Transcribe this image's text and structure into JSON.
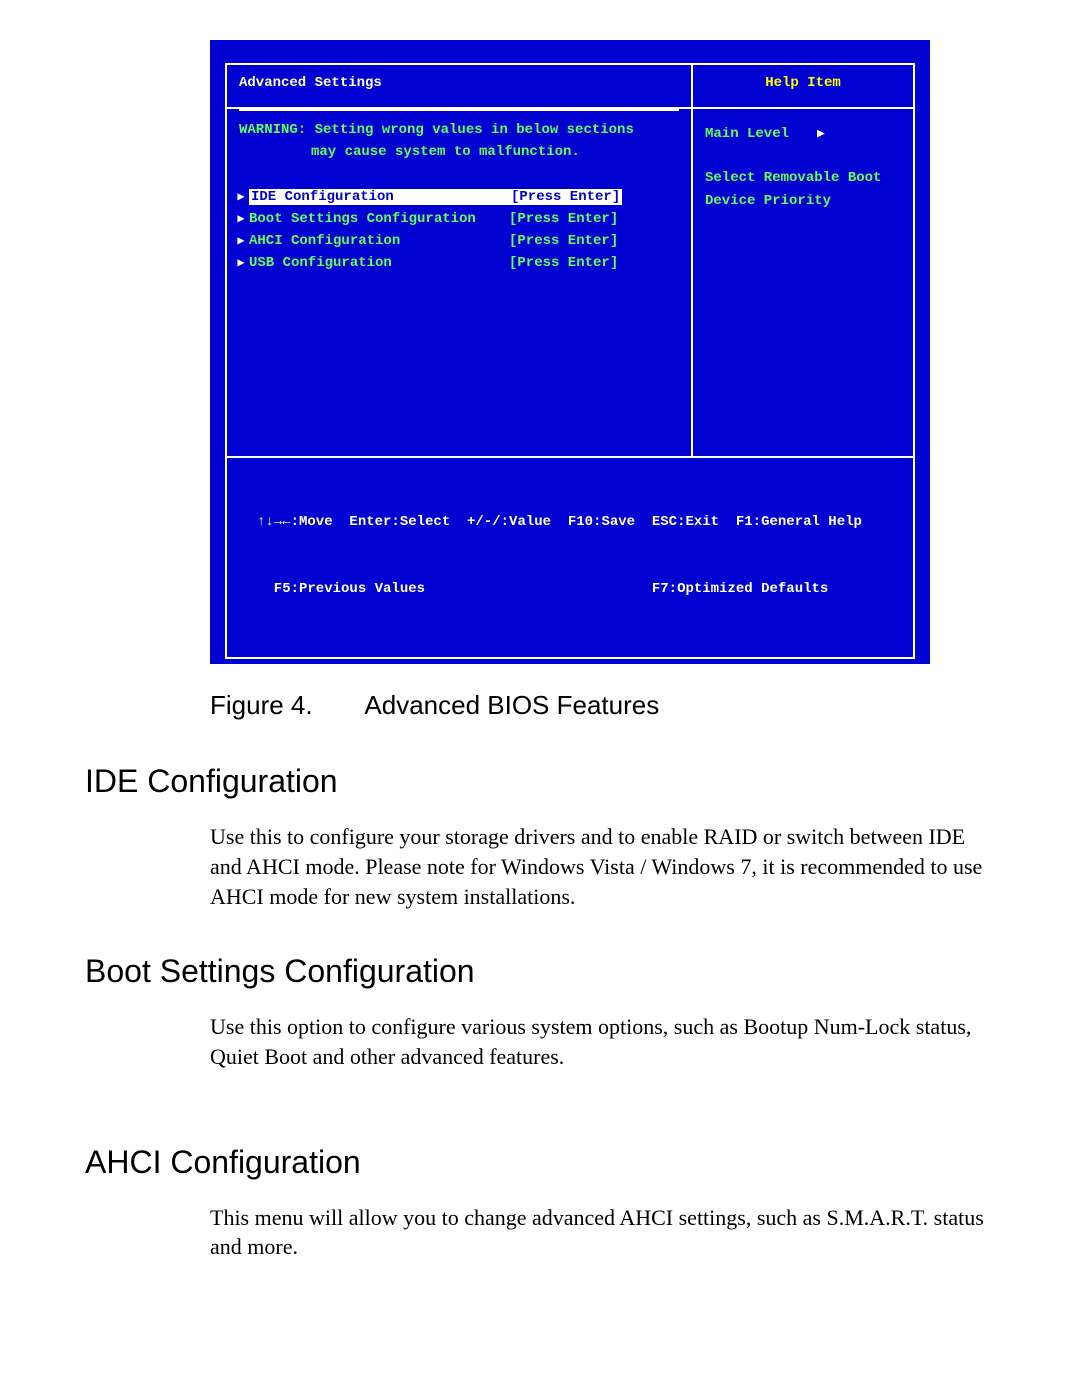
{
  "bios": {
    "title_left": "Advanced Settings",
    "title_right": "Help Item",
    "warning_line1": "WARNING: Setting wrong values in below sections",
    "warning_line2": "may cause system to malfunction.",
    "menu": [
      {
        "label": "IDE Configuration",
        "value": "[Press Enter]",
        "highlighted": true
      },
      {
        "label": "Boot Settings Configuration",
        "value": "[Press Enter]",
        "highlighted": false
      },
      {
        "label": "AHCI Configuration",
        "value": "[Press Enter]",
        "highlighted": false
      },
      {
        "label": "USB Configuration",
        "value": "[Press Enter]",
        "highlighted": false
      }
    ],
    "help_mainlevel": "Main Level",
    "help_line1": "Select Removable Boot",
    "help_line2": "Device Priority",
    "footer_line1": "↑↓→←:Move  Enter:Select  +/-/:Value  F10:Save  ESC:Exit  F1:General Help",
    "footer_line2": "  F5:Previous Values                           F7:Optimized Defaults"
  },
  "caption": {
    "num": "Figure 4.",
    "text": "Advanced BIOS Features"
  },
  "sections": {
    "ide": {
      "heading": "IDE Configuration",
      "body": "Use this to configure your storage drivers and to enable RAID or switch between IDE and AHCI mode. Please note for Windows Vista / Windows 7, it is recommended to use AHCI mode for new system installations."
    },
    "boot": {
      "heading": "Boot Settings Configuration",
      "body": "Use this option to configure various system options, such as Bootup Num-Lock status, Quiet Boot and other advanced features."
    },
    "ahci": {
      "heading": "AHCI Configuration",
      "body": "This menu will allow you to change advanced AHCI settings, such as S.M.A.R.T. status and more."
    }
  }
}
